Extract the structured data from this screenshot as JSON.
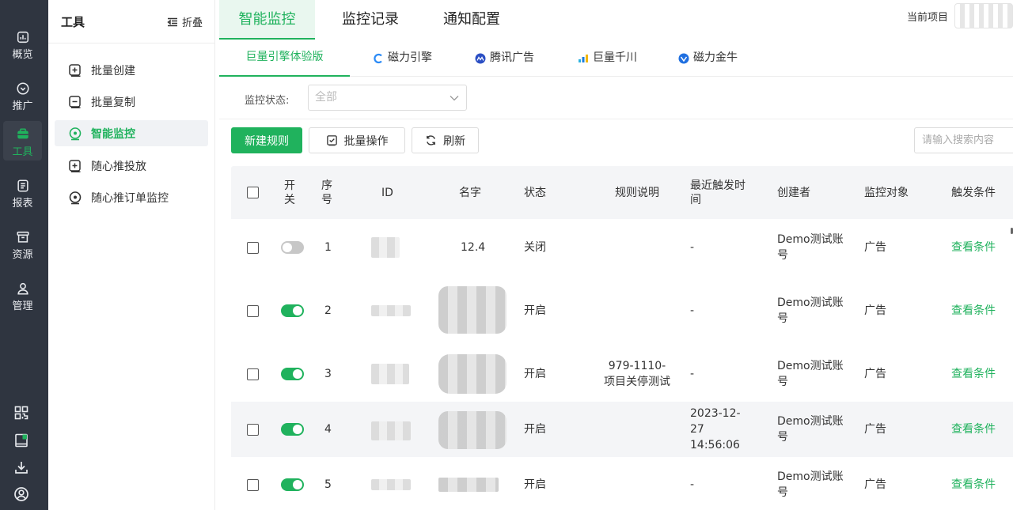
{
  "rail": {
    "items": [
      {
        "label": "概览",
        "icon": "dashboard-icon"
      },
      {
        "label": "推广",
        "icon": "promote-icon"
      },
      {
        "label": "工具",
        "icon": "toolbox-icon",
        "active": true
      },
      {
        "label": "报表",
        "icon": "report-icon"
      },
      {
        "label": "资源",
        "icon": "archive-icon"
      },
      {
        "label": "管理",
        "icon": "user-manage-icon"
      }
    ],
    "bottom_icons": [
      "qr-code-icon",
      "book-icon",
      "download-icon",
      "account-icon"
    ]
  },
  "sidebar": {
    "title": "工具",
    "collapse_label": "折叠",
    "items": [
      {
        "label": "批量创建",
        "icon": "add-square-icon"
      },
      {
        "label": "批量复制",
        "icon": "copy-square-icon"
      },
      {
        "label": "智能监控",
        "icon": "monitor-target-icon",
        "active": true
      },
      {
        "label": "随心推投放",
        "icon": "add-square-icon"
      },
      {
        "label": "随心推订单监控",
        "icon": "monitor-target-icon"
      }
    ]
  },
  "header": {
    "tabs": [
      {
        "label": "智能监控",
        "active": true
      },
      {
        "label": "监控记录"
      },
      {
        "label": "通知配置"
      }
    ],
    "project_label": "当前项目"
  },
  "platform_tabs": [
    {
      "label": "巨量引擎体验版",
      "active": true
    },
    {
      "label": "磁力引擎",
      "icon": "kuaishou-icon"
    },
    {
      "label": "腾讯广告",
      "icon": "tencent-ads-icon"
    },
    {
      "label": "巨量千川",
      "icon": "qianchuan-icon"
    },
    {
      "label": "磁力金牛",
      "icon": "jinniu-icon"
    }
  ],
  "filter": {
    "status_label": "监控状态:",
    "status_value": "全部"
  },
  "toolbar": {
    "new_rule": "新建规则",
    "batch_op": "批量操作",
    "refresh": "刷新",
    "search_placeholder": "请输入搜索内容"
  },
  "table": {
    "headers": {
      "switch": "开关",
      "index": "序号",
      "id": "ID",
      "name": "名字",
      "status": "状态",
      "desc": "规则说明",
      "last_trigger": "最近触发时间",
      "creator": "创建者",
      "target": "监控对象",
      "condition": "触发条件"
    },
    "rows": [
      {
        "on": false,
        "index": "1",
        "name": "12.4",
        "status": "关闭",
        "desc": "",
        "last_trigger": "-",
        "creator": "Demo测试账号",
        "target": "广告",
        "condition": "查看条件"
      },
      {
        "on": true,
        "index": "2",
        "name": "",
        "status": "开启",
        "desc": "",
        "last_trigger": "-",
        "creator": "Demo测试账号",
        "target": "广告",
        "condition": "查看条件"
      },
      {
        "on": true,
        "index": "3",
        "name": "",
        "status": "开启",
        "desc": "979-1110-项目关停测试",
        "last_trigger": "-",
        "creator": "Demo测试账号",
        "target": "广告",
        "condition": "查看条件"
      },
      {
        "on": true,
        "index": "4",
        "name": "",
        "status": "开启",
        "desc": "",
        "last_trigger": "2023-12-27 14:56:06",
        "creator": "Demo测试账号",
        "target": "广告",
        "condition": "查看条件"
      },
      {
        "on": true,
        "index": "5",
        "name": "",
        "status": "开启",
        "desc": "",
        "last_trigger": "-",
        "creator": "Demo测试账号",
        "target": "广告",
        "condition": "查看条件"
      }
    ]
  },
  "colors": {
    "accent": "#20b25d",
    "rail_bg": "#2f3540",
    "header_bg": "#f4f5f7"
  }
}
